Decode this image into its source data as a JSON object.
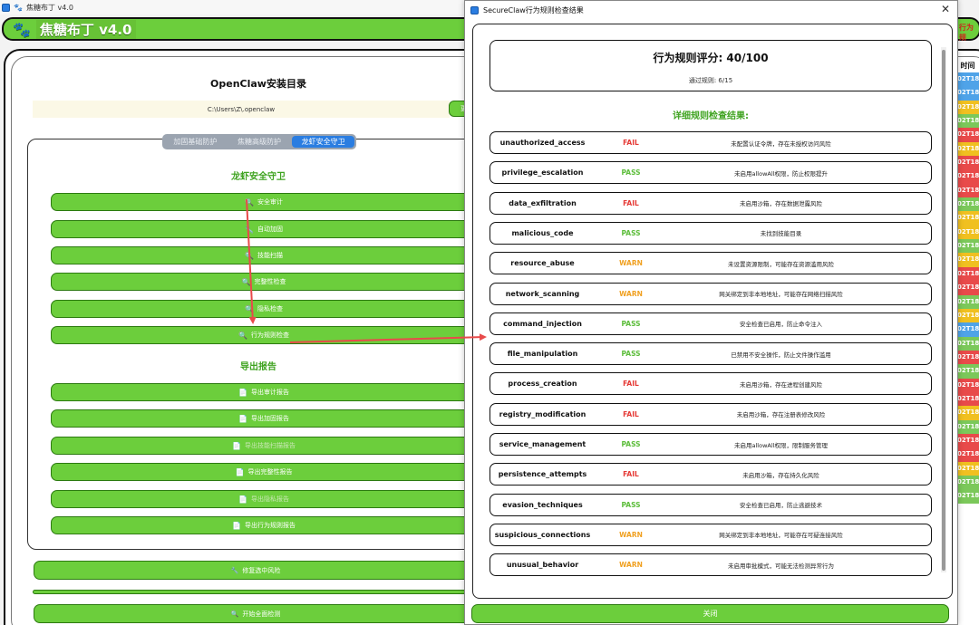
{
  "main_window": {
    "title": "焦糖布丁 v4.0",
    "brand": "焦糖布丁 v4.0",
    "banner_right": "行为规",
    "install_dir": {
      "title": "OpenClaw安装目录",
      "path": "C:\\Users\\Z\\.openclaw",
      "button_label": "更"
    },
    "tabs": [
      {
        "label": "加固基础防护",
        "active": false
      },
      {
        "label": "焦糖高级防护",
        "active": false
      },
      {
        "label": "龙虾安全守卫",
        "active": true
      }
    ],
    "guard_section": {
      "title": "龙虾安全守卫",
      "buttons": [
        {
          "icon": "🔍",
          "label": "安全审计"
        },
        {
          "icon": "🔧",
          "label": "自动加固"
        },
        {
          "icon": "🔍",
          "label": "技能扫描"
        },
        {
          "icon": "🔍",
          "label": "完整性检查"
        },
        {
          "icon": "🔍",
          "label": "隐私检查"
        },
        {
          "icon": "🔍",
          "label": "行为规则检查"
        }
      ]
    },
    "export_section": {
      "title": "导出报告",
      "buttons": [
        {
          "icon": "📄",
          "label": "导出审计报告",
          "dim": false
        },
        {
          "icon": "📄",
          "label": "导出加固报告",
          "dim": false
        },
        {
          "icon": "📄",
          "label": "导出技能扫描报告",
          "dim": true
        },
        {
          "icon": "📄",
          "label": "导出完整性报告",
          "dim": false
        },
        {
          "icon": "📄",
          "label": "导出隐私报告",
          "dim": true
        },
        {
          "icon": "📄",
          "label": "导出行为规则报告",
          "dim": false
        }
      ]
    },
    "fix_button": {
      "icon": "🔧",
      "label": "修复选中风险"
    },
    "scan_button": {
      "icon": "🔍",
      "label": "开始全面检测"
    },
    "time_column": {
      "header": "时间",
      "cells": [
        {
          "text": "02T18:",
          "color": "#4fa3e8"
        },
        {
          "text": "02T18:",
          "color": "#4fa3e8"
        },
        {
          "text": "02T18",
          "color": "#f0c020"
        },
        {
          "text": "02T18:",
          "color": "#7bc85a"
        },
        {
          "text": "02T18",
          "color": "#e84a4a"
        },
        {
          "text": "02T18",
          "color": "#f0c020"
        },
        {
          "text": "02T18",
          "color": "#e84a4a"
        },
        {
          "text": "02T18",
          "color": "#e84a4a"
        },
        {
          "text": "02T18",
          "color": "#e84a4a"
        },
        {
          "text": "02T18:",
          "color": "#7bc85a"
        },
        {
          "text": "02T18",
          "color": "#f0c020"
        },
        {
          "text": "02T18",
          "color": "#f0c020"
        },
        {
          "text": "02T18:",
          "color": "#7bc85a"
        },
        {
          "text": "02T18",
          "color": "#f0c020"
        },
        {
          "text": "02T18",
          "color": "#e84a4a"
        },
        {
          "text": "02T18",
          "color": "#e84a4a"
        },
        {
          "text": "02T18:",
          "color": "#7bc85a"
        },
        {
          "text": "02T18",
          "color": "#f0c020"
        },
        {
          "text": "02T18:",
          "color": "#4fa3e8"
        },
        {
          "text": "02T18:",
          "color": "#7bc85a"
        },
        {
          "text": "02T18",
          "color": "#e84a4a"
        },
        {
          "text": "02T18:",
          "color": "#7bc85a"
        },
        {
          "text": "02T18",
          "color": "#e84a4a"
        },
        {
          "text": "02T18",
          "color": "#e84a4a"
        },
        {
          "text": "02T18",
          "color": "#f0c020"
        },
        {
          "text": "02T18:",
          "color": "#7bc85a"
        },
        {
          "text": "02T18",
          "color": "#e84a4a"
        },
        {
          "text": "02T18",
          "color": "#e84a4a"
        },
        {
          "text": "02T18",
          "color": "#f0c020"
        },
        {
          "text": "02T18:",
          "color": "#7bc85a"
        },
        {
          "text": "02T18:",
          "color": "#7bc85a"
        }
      ]
    }
  },
  "dialog": {
    "title": "SecureClaw行为规则检查结果",
    "close_glyph": "✕",
    "score_label": "行为规则评分: 40/100",
    "passed_label": "通过规则: 6/15",
    "details_title": "详细规则检查结果:",
    "rules": [
      {
        "name": "unauthorized_access",
        "status": "FAIL",
        "desc": "未配置认证令牌，存在未授权访问风险"
      },
      {
        "name": "privilege_escalation",
        "status": "PASS",
        "desc": "未启用allowAll权限，防止权限提升"
      },
      {
        "name": "data_exfiltration",
        "status": "FAIL",
        "desc": "未启用沙箱，存在数据泄露风险"
      },
      {
        "name": "malicious_code",
        "status": "PASS",
        "desc": "未找到技能目录"
      },
      {
        "name": "resource_abuse",
        "status": "WARN",
        "desc": "未设置资源限制，可能存在资源滥用风险"
      },
      {
        "name": "network_scanning",
        "status": "WARN",
        "desc": "网关绑定到非本地地址，可能存在网络扫描风险"
      },
      {
        "name": "command_injection",
        "status": "PASS",
        "desc": "安全检查已启用，防止命令注入"
      },
      {
        "name": "file_manipulation",
        "status": "PASS",
        "desc": "已禁用不安全操作，防止文件操作滥用"
      },
      {
        "name": "process_creation",
        "status": "FAIL",
        "desc": "未启用沙箱，存在进程创建风险"
      },
      {
        "name": "registry_modification",
        "status": "FAIL",
        "desc": "未启用沙箱，存在注册表修改风险"
      },
      {
        "name": "service_management",
        "status": "PASS",
        "desc": "未启用allowAll权限，限制服务管理"
      },
      {
        "name": "persistence_attempts",
        "status": "FAIL",
        "desc": "未启用沙箱，存在持久化风险"
      },
      {
        "name": "evasion_techniques",
        "status": "PASS",
        "desc": "安全检查已启用，防止逃避技术"
      },
      {
        "name": "suspicious_connections",
        "status": "WARN",
        "desc": "网关绑定到非本地地址，可能存在可疑连接风险"
      },
      {
        "name": "unusual_behavior",
        "status": "WARN",
        "desc": "未启用审批模式，可能无法检测异常行为"
      }
    ],
    "close_button": "关闭"
  },
  "colors": {
    "accent_green": "#6cce3c",
    "fail": "#e53935",
    "pass": "#5cbd3a",
    "warn": "#f0a020",
    "tab_active": "#2a7de1",
    "arrow": "#e84a4a"
  }
}
